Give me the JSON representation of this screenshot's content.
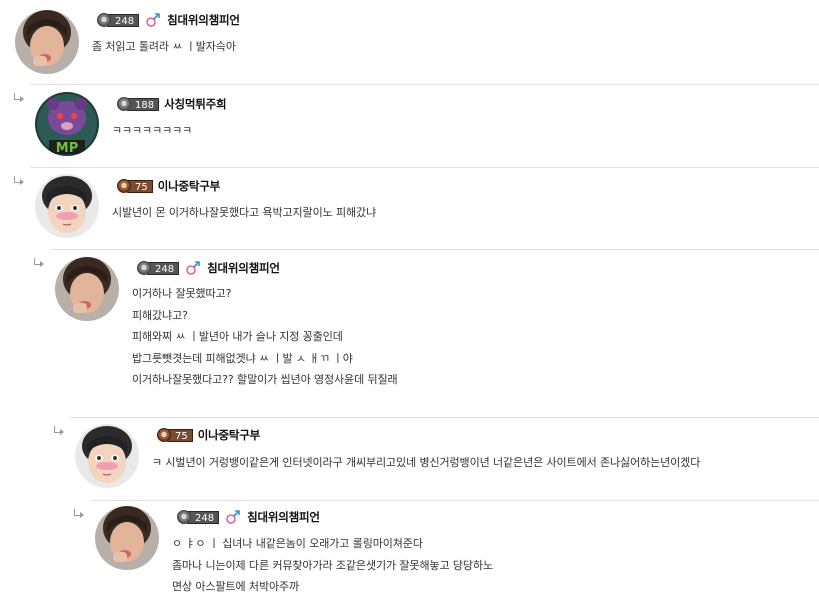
{
  "comments": [
    {
      "level": "248",
      "nickname": "침대위의챔피언",
      "lines": [
        "좀 처읽고 톨려라 ㅆ ㅣ발자슥아"
      ]
    },
    {
      "level": "188",
      "nickname": "사칭먹튀주희",
      "lines": [
        "ㅋㅋㅋㅋㅋㅋㅋㅋ"
      ]
    },
    {
      "level": "75",
      "nickname": "이나중탁구부",
      "lines": [
        "시발년이 몬 이거하나잘못했다고 욕박고지랄이노 피해갔냐"
      ]
    },
    {
      "level": "248",
      "nickname": "침대위의챔피언",
      "lines": [
        "이거하나 잘못했따고?",
        "피해갔냐고?",
        "피해와찌 ㅆ ㅣ발년아 내가 슬나 지정 꽁출인데",
        "밥그릇뺏겻는데 피해없겟냐 ㅆ ㅣ발 ㅅ ㅐㄲ ㅣ야",
        "이거하나잘못했다고?? 할말이가 씹년아 영정사윤데 뒤질래"
      ]
    },
    {
      "level": "75",
      "nickname": "이나중탁구부",
      "lines": [
        "ㅋ 시벌년이 거렁뱅이같은게 인터넷이라구 개씨부리고있네   병신거렁뱅이년 너같은년은 사이트에서 존나싫어하는년이겠다"
      ]
    },
    {
      "level": "248",
      "nickname": "침대위의챔피언",
      "lines": [
        "ㅇ ㅑㅇ ㅣ 십녀나 내같은놈이 오래가고 롤링마이쳐준다",
        "좀마나 니는이제 다른 커뮤찾아가라 조같은샛기가 잘못해놓고 당당하노",
        "면상 아스팔트에 처박아주까"
      ]
    }
  ]
}
